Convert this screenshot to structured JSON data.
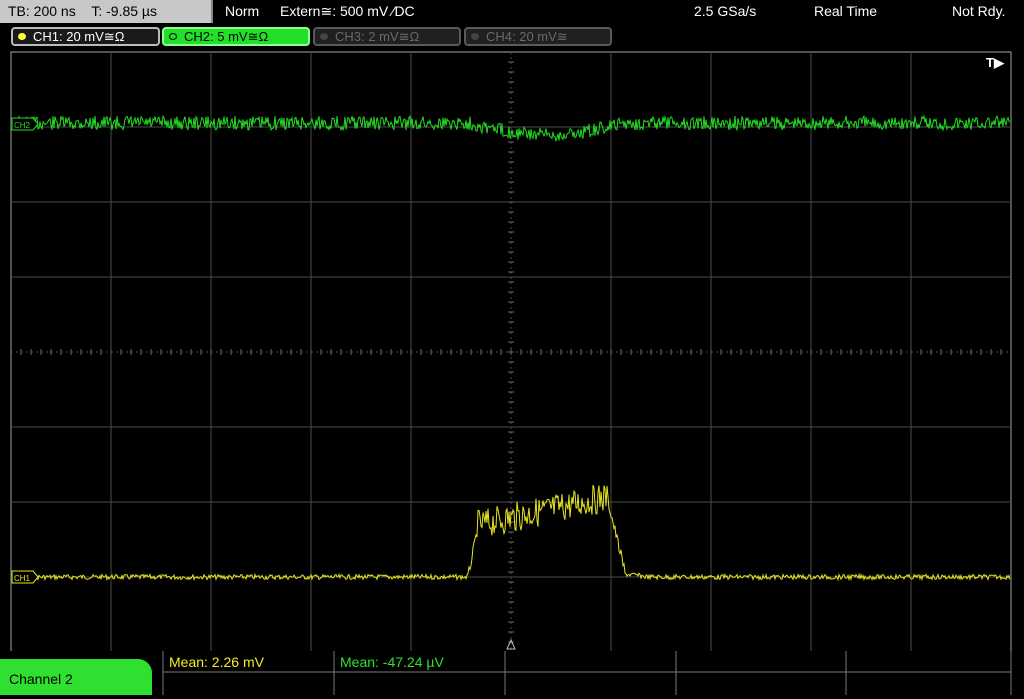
{
  "topbar": {
    "timebase": "TB: 200 ns",
    "trigger_time": "T: -9.85 µs",
    "mode": "Norm",
    "trigger_source": "Extern≅: 500 mV ⁄DC",
    "sample_rate": "2.5 GSa/s",
    "acq_mode": "Real Time",
    "status": "Not Rdy."
  },
  "channels": [
    {
      "label": "CH1: 20 mV≅Ω",
      "state": "on",
      "color": "#ffff40"
    },
    {
      "label": "CH2: 5 mV≅Ω",
      "state": "selected",
      "color": "#22e02a"
    },
    {
      "label": "CH3: 2 mV≅Ω",
      "state": "off",
      "color": "#6a6a6a"
    },
    {
      "label": "CH4: 20 mV≅",
      "state": "off",
      "color": "#6a6a6a"
    }
  ],
  "screen": {
    "trigger_marker": "T▶",
    "ch1_marker": "CH1",
    "ch2_marker": "CH2"
  },
  "measurements": {
    "ch1_mean": "Mean: 2.26 mV",
    "ch2_mean": "Mean: -47.24 µV"
  },
  "bottom": {
    "active_channel_tab": "Channel 2"
  }
}
